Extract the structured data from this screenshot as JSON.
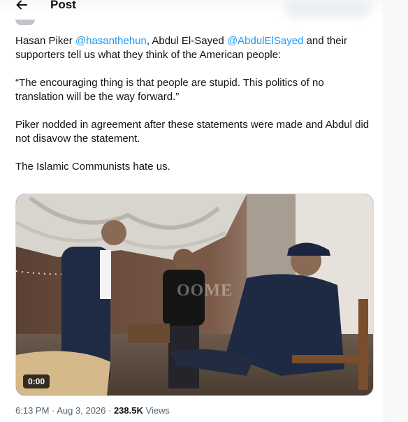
{
  "header": {
    "title": "Post",
    "back_icon": "arrow-left-icon"
  },
  "tweet": {
    "p1": {
      "t1": "Hasan Piker ",
      "m1": "@hasanthehun",
      "t2": ", Abdul El-Sayed ",
      "m2": "@AbdulElSayed",
      "t3": " and their supporters tell us what they think of the American people:"
    },
    "p2": "“The encouraging thing is that people are stupid. This politics of no translation will be the way forward.”",
    "p3": "Piker nodded in agreement after these statements were made and Abdul did not disavow the statement.",
    "p4": "The Islamic Communists hate us."
  },
  "media": {
    "timer": "0:00",
    "watermark": "OOME"
  },
  "meta": {
    "time": "6:13 PM",
    "sep1": " · ",
    "date": "Aug 3, 2026",
    "sep2": " · ",
    "views_count": "238.5K",
    "views_label": " Views"
  },
  "colors": {
    "link": "#1d9bf0",
    "text": "#0f1419",
    "secondary": "#536471"
  }
}
